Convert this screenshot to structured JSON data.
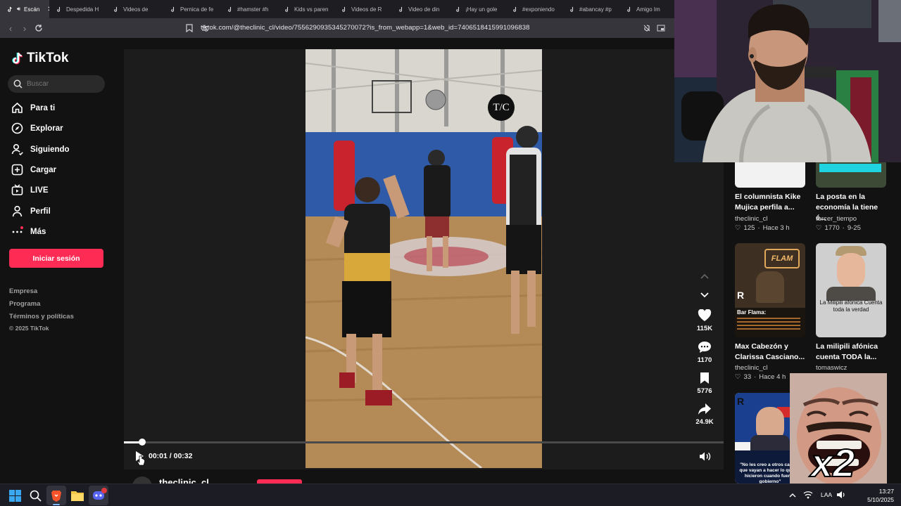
{
  "browser": {
    "tabs": [
      {
        "label": "Escán"
      },
      {
        "label": "Despedida H"
      },
      {
        "label": "Videos de"
      },
      {
        "label": "Pernica de fe"
      },
      {
        "label": "#hamster #h"
      },
      {
        "label": "Kids vs paren"
      },
      {
        "label": "Videos de R"
      },
      {
        "label": "Video de din"
      },
      {
        "label": "¡Hay un gole"
      },
      {
        "label": "#exponiendo"
      },
      {
        "label": "#abancay #p"
      },
      {
        "label": "Amigo Im"
      }
    ],
    "url": "tiktok.com/@theclinic_cl/video/7556290935345270072?is_from_webapp=1&web_id=7406518415991096838"
  },
  "sidebar": {
    "brand": "TikTok",
    "search_placeholder": "Buscar",
    "items": [
      {
        "label": "Para ti",
        "icon": "home-icon"
      },
      {
        "label": "Explorar",
        "icon": "compass-icon"
      },
      {
        "label": "Siguiendo",
        "icon": "following-icon"
      },
      {
        "label": "Cargar",
        "icon": "upload-icon"
      },
      {
        "label": "LIVE",
        "icon": "live-icon"
      },
      {
        "label": "Perfil",
        "icon": "profile-icon"
      },
      {
        "label": "Más",
        "icon": "more-icon"
      }
    ],
    "login_label": "Iniciar sesión",
    "footer": [
      "Empresa",
      "Programa",
      "Términos y políticas",
      "© 2025 TikTok"
    ]
  },
  "video": {
    "badge": "T/C",
    "current_time": "00:01",
    "separator": "/",
    "duration": "00:32",
    "progress": 0.03,
    "author_peek": "theclinic_cl",
    "actions": {
      "likes": "115K",
      "comments": "1170",
      "saves": "5776",
      "shares": "24.9K"
    }
  },
  "related": [
    {
      "title": "El columnista Kike Mujica perfila a...",
      "author": "theclinic_cl",
      "likes": "125",
      "age": "Hace 3 h"
    },
    {
      "title": "La posta en la economía la tiene é...",
      "author": "tercer_tiempo",
      "likes": "1770",
      "age": "9-25"
    },
    {
      "title": "Max Cabezón y Clarissa Casciano...",
      "author": "theclinic_cl",
      "likes": "33",
      "age": "Hace 4 h",
      "thumb_text": "Bar Flama:"
    },
    {
      "title": "La milipili afónica cuenta TODA la...",
      "author": "tomaswicz",
      "likes": "",
      "age": "",
      "thumb_text": "La Milipili afónica Cuenta toda la verdad"
    },
    {
      "title": "",
      "author": "",
      "likes": "",
      "age": "",
      "thumb_text": "\"No les creo a otros candi... que vayan a hacer lo que no hicieron cuando fueron gobierno\""
    }
  ],
  "overlay": {
    "multiplier": "x2"
  },
  "taskbar": {
    "language": "LAA",
    "time": "13:27",
    "date": "5/10/2025"
  },
  "colors": {
    "accent": "#fe2c55",
    "background": "#121212",
    "player_bg": "#1c1c1c"
  }
}
